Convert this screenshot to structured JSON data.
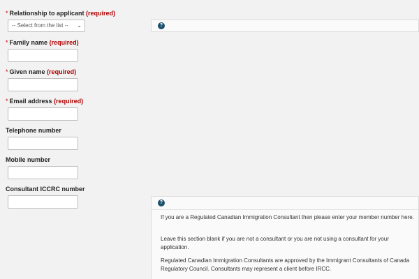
{
  "form": {
    "required_marker": "*",
    "required_text": "(required)",
    "relationship": {
      "label": "Relationship to applicant",
      "selected": "-- Select from the list --"
    },
    "family_name": {
      "label": "Family name",
      "value": ""
    },
    "given_name": {
      "label": "Given name",
      "value": ""
    },
    "email": {
      "label": "Email address",
      "value": ""
    },
    "telephone": {
      "label": "Telephone number",
      "value": ""
    },
    "mobile": {
      "label": "Mobile number",
      "value": ""
    },
    "consultant": {
      "label": "Consultant ICCRC number",
      "value": ""
    }
  },
  "help": {
    "icon_glyph": "?",
    "paragraphs": [
      "If you are a Regulated Canadian Immigration Consultant then please enter your member number here.",
      "Leave this section blank if you are not a consultant or you are not using a consultant for your application.",
      "Regulated Canadian Immigration Consultants are approved by the Immigrant Consultants of Canada Regulatory Council. Consultants may represent a client before IRCC."
    ]
  },
  "icons": {
    "dropdown": "chevron-down-icon",
    "help": "question-circle-icon"
  },
  "colors": {
    "required": "#b00000",
    "help_icon": "#1c4f6b",
    "background": "#f2f2f2"
  }
}
